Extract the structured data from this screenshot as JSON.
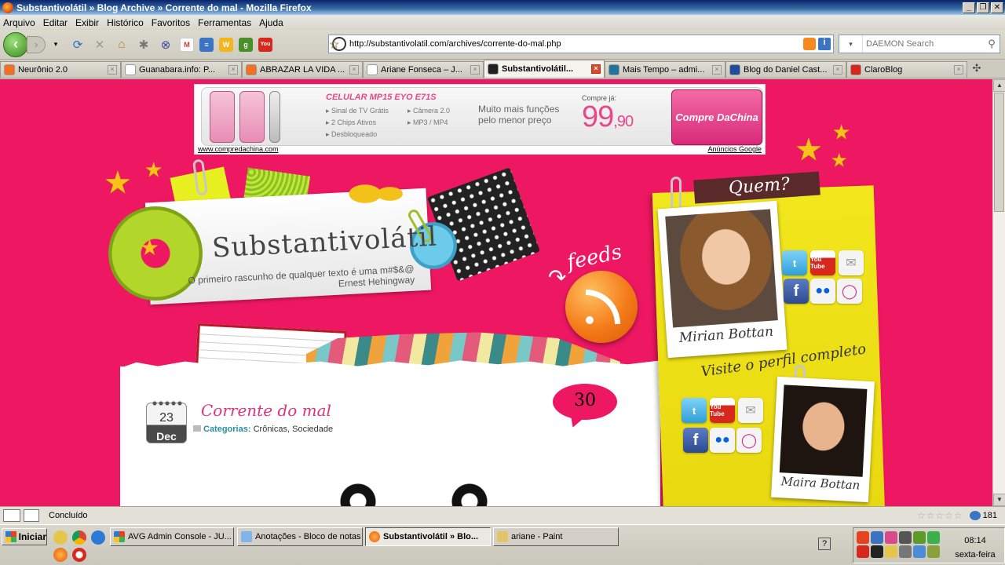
{
  "window": {
    "title": "Substantivolátil » Blog Archive » Corrente do mal - Mozilla Firefox",
    "controls": [
      "_",
      "❐",
      "✕"
    ]
  },
  "menu": [
    "Arquivo",
    "Editar",
    "Exibir",
    "Histórico",
    "Favoritos",
    "Ferramentas",
    "Ajuda"
  ],
  "toolbar": {
    "url": "http://substantivolatil.com/archives/corrente-do-mal.php",
    "search_placeholder": "DAEMON Search"
  },
  "tabs": [
    {
      "label": "Neurônio 2.0",
      "color": "#f36f21",
      "active": false
    },
    {
      "label": "Guanabara.info: P...",
      "color": "#ffffff",
      "active": false
    },
    {
      "label": "ABRAZAR LA VIDA ...",
      "color": "#f36f21",
      "active": false
    },
    {
      "label": "Ariane Fonseca – J...",
      "color": "#ffffff",
      "active": false
    },
    {
      "label": "Substantivolátil...",
      "color": "#222222",
      "active": true
    },
    {
      "label": "Mais Tempo – admi...",
      "color": "#21759b",
      "active": false
    },
    {
      "label": "Blog do Daniel Cast...",
      "color": "#1f4e9a",
      "active": false
    },
    {
      "label": "ClaroBlog",
      "color": "#d9261c",
      "active": false
    }
  ],
  "ad": {
    "title": "CELULAR MP15 EYO E71S",
    "features_left": [
      "Sinal de TV Grátis",
      "2 Chips Ativos",
      "Desbloqueado"
    ],
    "features_right": [
      "Câmera 2.0",
      "MP3 / MP4"
    ],
    "tagline_1": "Muito mais funções",
    "tagline_2": "pelo menor preço",
    "buy_label": "Compre já:",
    "price_main": "99",
    "price_cents": ",90",
    "cta": "Compre DaChina",
    "source_url": "www.compredachina.com",
    "ads_by": "Anúncios Google"
  },
  "blog": {
    "title": "Substantivolátil",
    "quote": "O primeiro rascunho de qualquer texto é uma m#$&@",
    "quote_author": "Ernest Hehingway",
    "feeds_label": "feeds"
  },
  "post": {
    "day": "23",
    "month": "Dec",
    "title": "Corrente do mal",
    "categories_label": "Categorias:",
    "categories": "Crônicas, Sociedade",
    "comments": "30"
  },
  "sidebar": {
    "heading": "Quem?",
    "visit_text": "Visite o perfil completo",
    "author_1": "Mirian Bottan",
    "author_2": "Maira Bottan"
  },
  "status": {
    "text": "Concluído",
    "rating": "☆☆☆☆☆",
    "count": "181"
  },
  "taskbar": {
    "start": "Iniciar",
    "tasks": [
      {
        "label": "AVG Admin Console - JU...",
        "active": false
      },
      {
        "label": "Anotações - Bloco de notas",
        "active": false
      },
      {
        "label": "Substantivolátil » Blo...",
        "active": true
      },
      {
        "label": "ariane - Paint",
        "active": false
      }
    ],
    "time": "08:14",
    "weekday": "sexta-feira"
  }
}
